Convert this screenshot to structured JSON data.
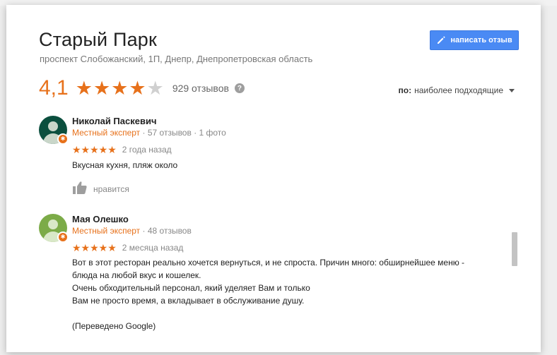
{
  "place": {
    "title": "Старый Парк",
    "address": "проспект Слобожанский, 1П, Днепр, Днепропетровская область",
    "write_review_label": "написать отзыв",
    "rating": "4,1",
    "rating_stars": 4,
    "reviews_count": "929 отзывов",
    "help_glyph": "?"
  },
  "sort": {
    "label": "по:",
    "value": "наиболее подходящие"
  },
  "reviews": [
    {
      "name": "Николай Паскевич",
      "badge": "Местный эксперт",
      "stats": " · 57 отзывов · 1 фото",
      "stars": "★★★★★",
      "date": "2 года назад",
      "text": "Вкусная кухня, пляж около",
      "like_label": "нравится",
      "avatar_color": "#0b4f3e"
    },
    {
      "name": "Мая Олешко",
      "badge": "Местный эксперт",
      "stats": " · 48 отзывов",
      "stars": "★★★★★",
      "date": "2 месяца назад",
      "text_lines": [
        "Вот в этот ресторан реально хочется вернуться, и не спроста. Причин много: обширнейшее меню -",
        "блюда на любой вкус и кошелек.",
        "Очень обходительный персонал, який уделяет Вам и только",
        "Вам не просто время, а вкладывает в обслуживание душу.",
        "",
        "(Переведено Google)"
      ],
      "avatar_color": "#7cab48"
    }
  ],
  "colors": {
    "accent": "#e7711b",
    "button": "#4a8af4"
  }
}
